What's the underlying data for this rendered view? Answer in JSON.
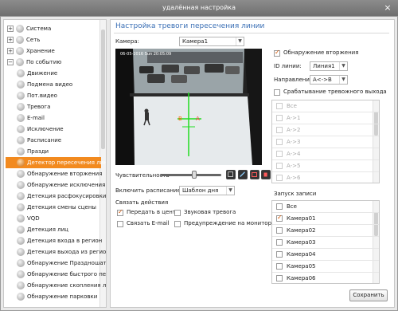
{
  "window": {
    "title": "удалённая настройка",
    "close_label": "×"
  },
  "sidebar": {
    "items": [
      {
        "label": "Система",
        "toggle": "+"
      },
      {
        "label": "Сеть",
        "toggle": "+"
      },
      {
        "label": "Хранение",
        "toggle": "+"
      },
      {
        "label": "По событию",
        "toggle": "−"
      },
      {
        "label": "Движение"
      },
      {
        "label": "Подмена видео"
      },
      {
        "label": "Пот.видео"
      },
      {
        "label": "Тревога"
      },
      {
        "label": "E-mail"
      },
      {
        "label": "Исключение"
      },
      {
        "label": "Расписание"
      },
      {
        "label": "Празди"
      },
      {
        "label": "Детектор пересечения линии",
        "selected": true
      },
      {
        "label": "Обнаружение вторжения"
      },
      {
        "label": "Обнаружение исключения"
      },
      {
        "label": "Детекция расфокусировки"
      },
      {
        "label": "Детекция смены сцены"
      },
      {
        "label": "VQD"
      },
      {
        "label": "Детекция лиц"
      },
      {
        "label": "Детекция входа в регион"
      },
      {
        "label": "Детекция выхода из региона"
      },
      {
        "label": "Обнаружение Праздношат..."
      },
      {
        "label": "Обнаружение быстрого пе..."
      },
      {
        "label": "Обнаружение скопления л..."
      },
      {
        "label": "Обнаружение парковки"
      }
    ]
  },
  "main": {
    "title": "Настройка тревоги пересечения линии",
    "camera_label": "Камера:",
    "camera_value": "Камера1",
    "osd_text": "06-05-2016 Sun 20:05:09",
    "sensitivity_label": "Чувствительность",
    "sensitivity_level": 0.55,
    "schedule_label": "Включить расписание:",
    "schedule_value": "Шаблон дня",
    "link_actions_label": "Связать действия",
    "actions": {
      "notify_center": {
        "label": "Передать в центр",
        "checked": true
      },
      "audio_alarm": {
        "label": "Звуковая тревога",
        "checked": false
      },
      "link_email": {
        "label": "Связать E-mail",
        "checked": false
      },
      "monitor_warning": {
        "label": "Предупреждение на мониторе",
        "checked": false
      }
    },
    "intrusion": {
      "label": "Обнаружение вторжения",
      "checked": true
    },
    "line_id_label": "ID линии:",
    "line_id_value": "Линия1",
    "direction_label": "Направление:",
    "direction_value": "A<->B",
    "alarm_output": {
      "label": "Срабатывание тревожного выхода",
      "checked": false
    },
    "output_list": [
      "Все",
      "A->1",
      "A->2",
      "A->3",
      "A->4",
      "A->5",
      "A->6"
    ],
    "record_label": "Запуск записи",
    "record_list": [
      {
        "label": "Все",
        "checked": false
      },
      {
        "label": "Камера01",
        "checked": true
      },
      {
        "label": "Камера02",
        "checked": false
      },
      {
        "label": "Камера03",
        "checked": false
      },
      {
        "label": "Камера04",
        "checked": false
      },
      {
        "label": "Камера05",
        "checked": false
      },
      {
        "label": "Камера06",
        "checked": false
      }
    ],
    "save_label": "Сохранить",
    "accent_color": "#f28a1f",
    "title_color": "#3a6fb5"
  }
}
